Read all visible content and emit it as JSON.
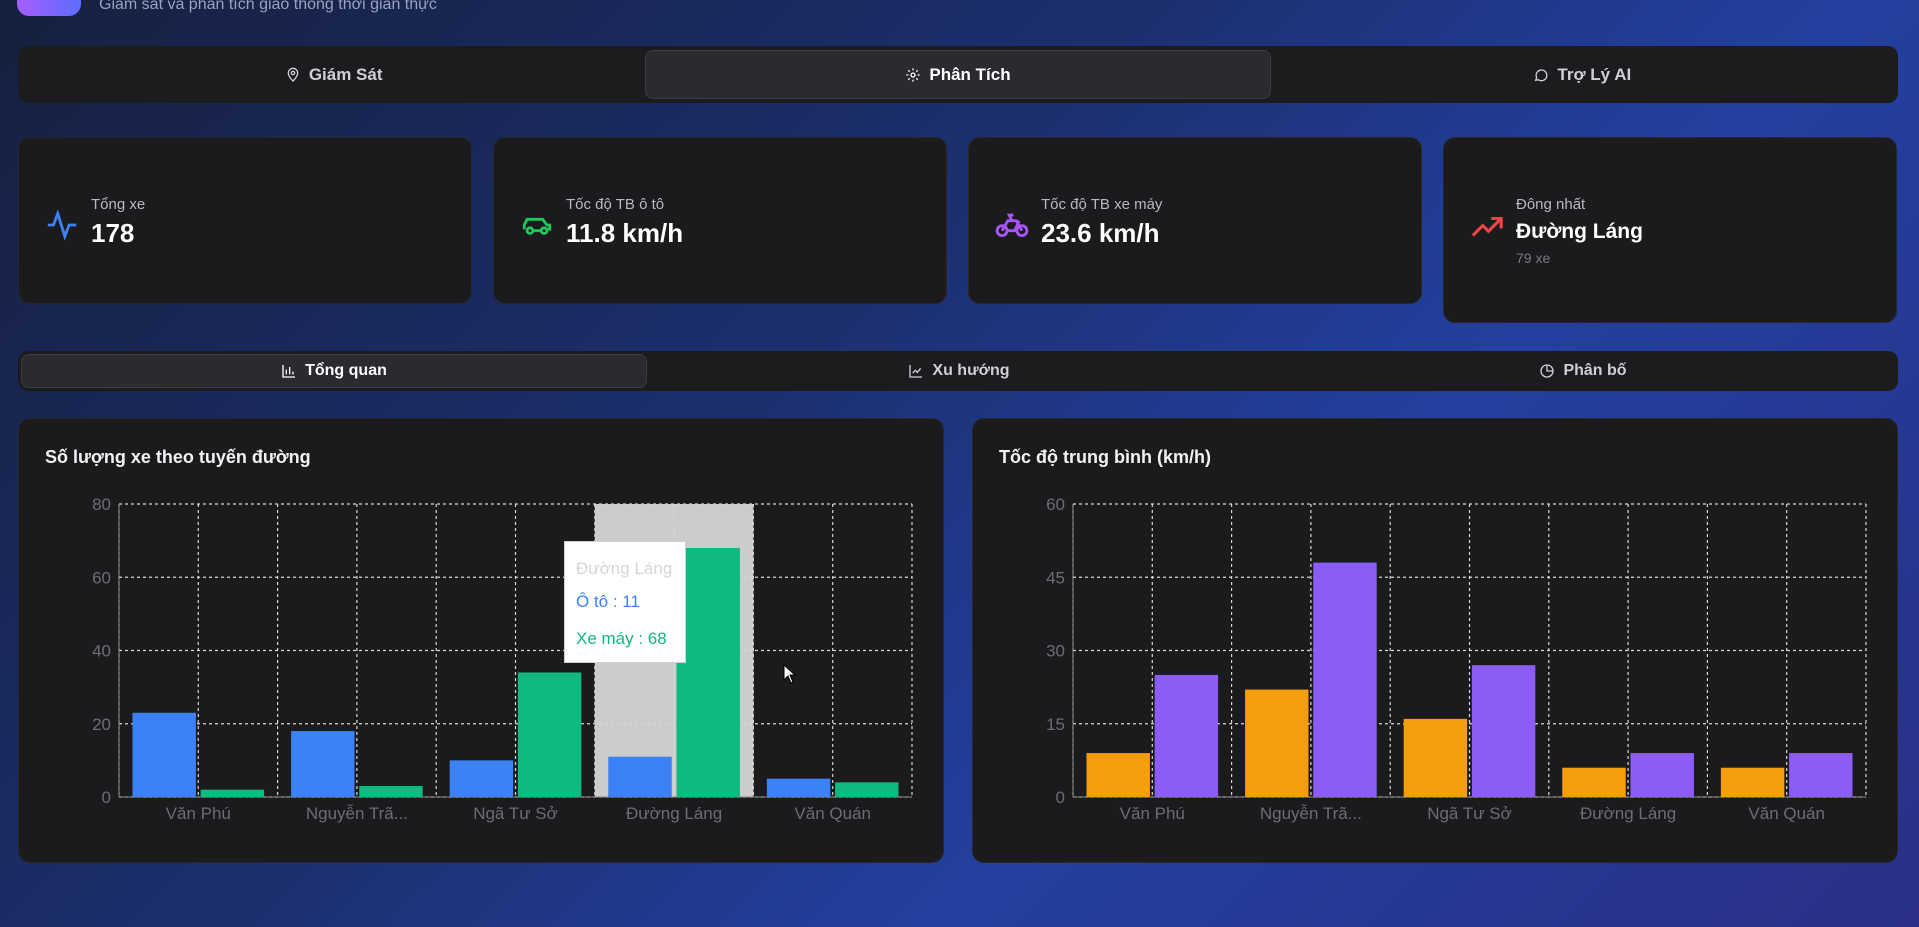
{
  "header": {
    "subtitle": "Giám sát và phân tích giao thông thời gian thực"
  },
  "main_tabs": [
    {
      "label": "Giám Sát",
      "icon": "map-pin-icon"
    },
    {
      "label": "Phân Tích",
      "icon": "gear-icon",
      "active": true
    },
    {
      "label": "Trợ Lý AI",
      "icon": "chat-icon"
    }
  ],
  "stats": [
    {
      "label": "Tổng xe",
      "value": "178",
      "icon": "activity-icon",
      "color": "#3b82f6"
    },
    {
      "label": "Tốc độ TB ô tô",
      "value": "11.8 km/h",
      "icon": "car-icon",
      "color": "#22c55e"
    },
    {
      "label": "Tốc độ TB xe máy",
      "value": "23.6 km/h",
      "icon": "bike-icon",
      "color": "#a855f7"
    },
    {
      "label": "Đông nhất",
      "value": "Đường Láng",
      "sub": "79 xe",
      "icon": "trending-up-icon",
      "color": "#ef4444"
    }
  ],
  "sub_tabs": [
    {
      "label": "Tổng quan",
      "icon": "bar-chart-icon",
      "active": true
    },
    {
      "label": "Xu hướng",
      "icon": "line-chart-icon"
    },
    {
      "label": "Phân bố",
      "icon": "pie-chart-icon"
    }
  ],
  "tooltip": {
    "title": "Đường Láng",
    "car": "Ô tô : 11",
    "moto": "Xe máy : 68"
  },
  "chart_data": [
    {
      "type": "bar",
      "title": "Số lượng xe theo tuyến đường",
      "categories": [
        "Văn Phú",
        "Nguyễn Trã...",
        "Ngã Tư Sở",
        "Đường Láng",
        "Văn Quán"
      ],
      "series": [
        {
          "name": "Ô tô",
          "values": [
            23,
            18,
            10,
            11,
            5
          ],
          "color": "#3b82f6"
        },
        {
          "name": "Xe máy",
          "values": [
            2,
            3,
            34,
            68,
            4
          ],
          "color": "#10b981"
        }
      ],
      "ylim": [
        0,
        80
      ],
      "yticks": [
        0,
        20,
        40,
        60,
        80
      ],
      "grid": true,
      "highlight_index": 3
    },
    {
      "type": "bar",
      "title": "Tốc độ trung bình (km/h)",
      "categories": [
        "Văn Phú",
        "Nguyễn Trã...",
        "Ngã Tư Sở",
        "Đường Láng",
        "Văn Quán"
      ],
      "series": [
        {
          "values": [
            9,
            22,
            16,
            6,
            6
          ],
          "color": "#f59e0b"
        },
        {
          "values": [
            25,
            48,
            27,
            9,
            9
          ],
          "color": "#8b5cf6"
        }
      ],
      "ylim": [
        0,
        60
      ],
      "yticks": [
        0,
        15,
        30,
        45,
        60
      ],
      "grid": true
    }
  ]
}
